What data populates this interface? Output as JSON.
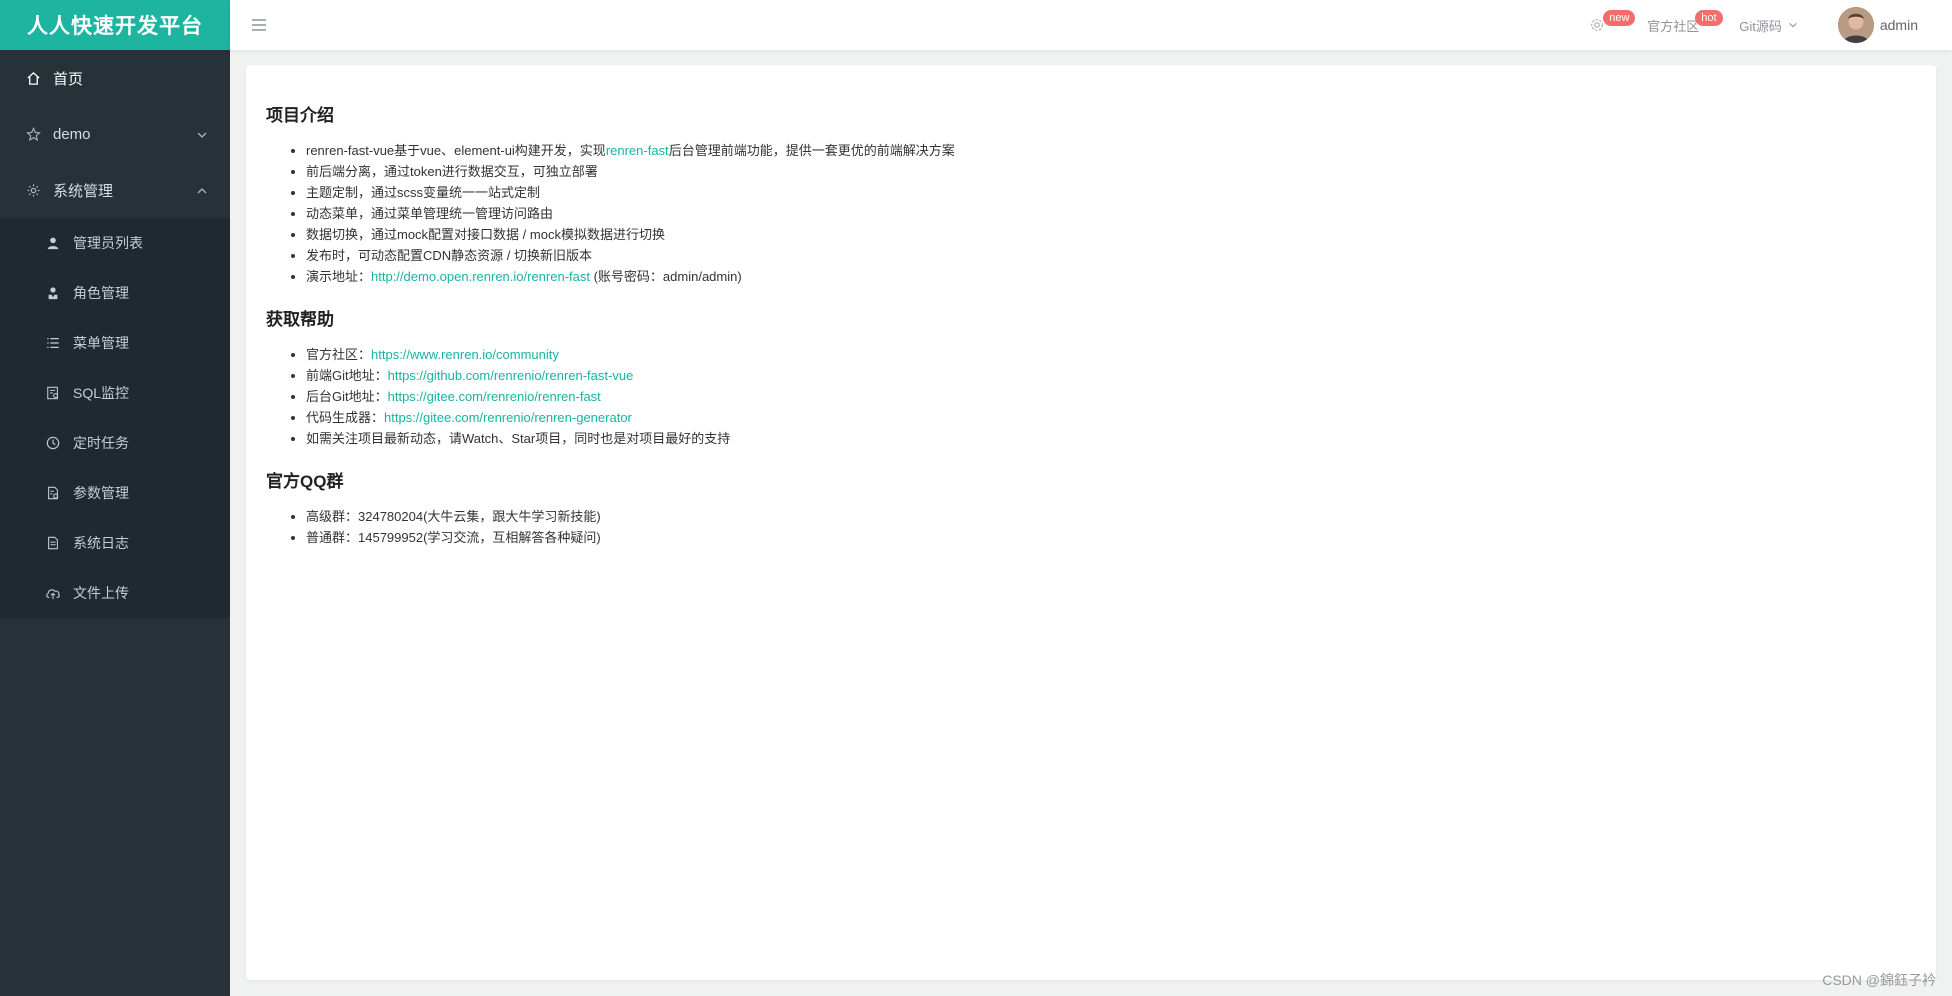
{
  "brand": "人人快速开发平台",
  "menu": {
    "home": "首页",
    "demo": "demo",
    "system": "系统管理",
    "sub": [
      {
        "label": "管理员列表",
        "icon": "user-icon"
      },
      {
        "label": "角色管理",
        "icon": "role-icon"
      },
      {
        "label": "菜单管理",
        "icon": "list-icon"
      },
      {
        "label": "SQL监控",
        "icon": "sql-icon"
      },
      {
        "label": "定时任务",
        "icon": "clock-icon"
      },
      {
        "label": "参数管理",
        "icon": "params-icon"
      },
      {
        "label": "系统日志",
        "icon": "log-icon"
      },
      {
        "label": "文件上传",
        "icon": "upload-icon"
      }
    ]
  },
  "header": {
    "badge_new": "new",
    "community": "官方社区",
    "badge_hot": "hot",
    "git": "Git源码",
    "user": "admin"
  },
  "sections": {
    "intro_title": "项目介绍",
    "intro": {
      "i1_pre": "renren-fast-vue基于vue、element-ui构建开发，实现",
      "i1_link": "renren-fast",
      "i1_post": "后台管理前端功能，提供一套更优的前端解决方案",
      "i2": "前后端分离，通过token进行数据交互，可独立部署",
      "i3": "主题定制，通过scss变量统一一站式定制",
      "i4": "动态菜单，通过菜单管理统一管理访问路由",
      "i5": "数据切换，通过mock配置对接口数据 / mock模拟数据进行切换",
      "i6": "发布时，可动态配置CDN静态资源 / 切换新旧版本",
      "i7_pre": "演示地址：",
      "i7_link": "http://demo.open.renren.io/renren-fast",
      "i7_post": " (账号密码：admin/admin)"
    },
    "help_title": "获取帮助",
    "help": {
      "h1_pre": "官方社区：",
      "h1_link": "https://www.renren.io/community",
      "h2_pre": "前端Git地址：",
      "h2_link": "https://github.com/renrenio/renren-fast-vue",
      "h3_pre": "后台Git地址：",
      "h3_link": "https://gitee.com/renrenio/renren-fast",
      "h4_pre": "代码生成器：",
      "h4_link": "https://gitee.com/renrenio/renren-generator",
      "h5": "如需关注项目最新动态，请Watch、Star项目，同时也是对项目最好的支持"
    },
    "qq_title": "官方QQ群",
    "qq": {
      "q1": "高级群：324780204(大牛云集，跟大牛学习新技能)",
      "q2": "普通群：145799952(学习交流，互相解答各种疑问)"
    }
  },
  "watermark": "CSDN @錦鈺子衿",
  "colors": {
    "brand": "#1db4a0",
    "sidebar": "#263238",
    "link": "#17b3a3",
    "badge": "#f56c6c"
  }
}
